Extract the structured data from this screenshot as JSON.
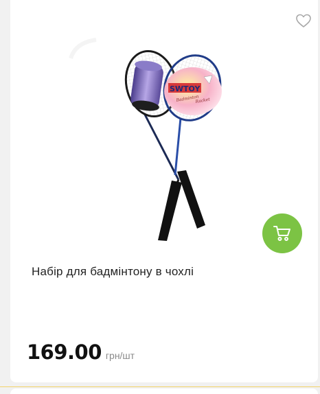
{
  "product": {
    "title": "Набір для бадмінтону в чохлі",
    "price": "169.00",
    "unit": "грн/шт",
    "image": {
      "package_brand": "SWTOY",
      "package_text_1": "Badminton",
      "package_text_2": "Racket"
    }
  },
  "icons": {
    "favorite": "heart-outline-icon",
    "cart": "shopping-cart-icon"
  },
  "colors": {
    "cart_button": "#7cc344",
    "divider": "#f2d46a"
  }
}
